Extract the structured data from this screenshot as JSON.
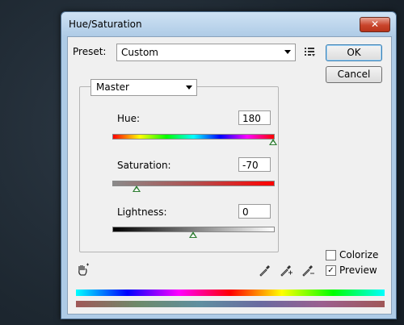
{
  "window": {
    "title": "Hue/Saturation",
    "close_label": "✕"
  },
  "preset": {
    "label": "Preset:",
    "value": "Custom"
  },
  "buttons": {
    "ok": "OK",
    "cancel": "Cancel"
  },
  "channel": {
    "value": "Master"
  },
  "hue": {
    "label": "Hue:",
    "value": "180",
    "slider_fraction": 1.0
  },
  "saturation": {
    "label": "Saturation:",
    "value": "-70",
    "slider_fraction": 0.15
  },
  "lightness": {
    "label": "Lightness:",
    "value": "0",
    "slider_fraction": 0.5
  },
  "colorize": {
    "label": "Colorize",
    "checked": false
  },
  "preview": {
    "label": "Preview",
    "checked": true,
    "check_glyph": "✓"
  },
  "icons": [
    "hand-adjust-icon",
    "eyedropper-icon",
    "eyedropper-plus-icon",
    "eyedropper-minus-icon",
    "preset-menu-icon"
  ]
}
